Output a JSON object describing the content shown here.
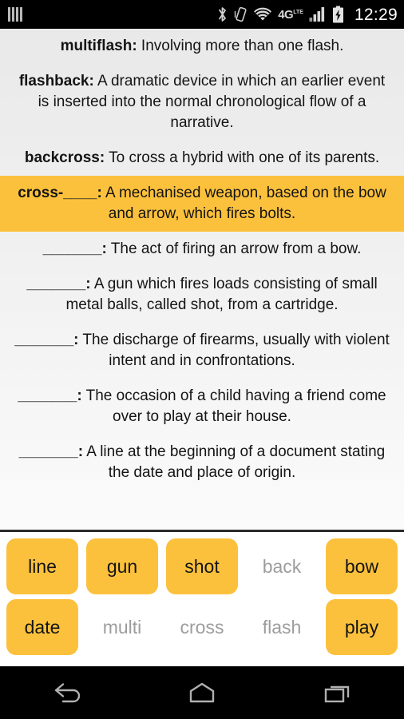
{
  "status_bar": {
    "app_icon": "bars-icon",
    "icons": [
      {
        "name": "bluetooth-icon",
        "label": "Bluetooth"
      },
      {
        "name": "vibrate-icon",
        "label": "Vibrate"
      },
      {
        "name": "wifi-icon",
        "label": "Wi-Fi"
      },
      {
        "name": "network-4g-lte-icon",
        "label_big": "4G",
        "label_small": "LTE"
      },
      {
        "name": "cellular-signal-icon",
        "label": "Signal"
      },
      {
        "name": "battery-charging-icon",
        "label": "Battery charging"
      }
    ],
    "clock": "12:29"
  },
  "content": {
    "definitions": [
      {
        "term": "multiflash",
        "separator": ":",
        "text": " Involving more than one flash.",
        "state": "solved",
        "highlighted": false
      },
      {
        "term": "flashback",
        "separator": ":",
        "text": " A dramatic device in which an earlier event is inserted into the normal chronological flow of a narrative.",
        "state": "solved",
        "highlighted": false
      },
      {
        "term": "backcross",
        "separator": ":",
        "text": " To cross a hybrid with one of its parents.",
        "state": "solved",
        "highlighted": false
      },
      {
        "term": "cross-____",
        "separator": ":",
        "text": " A mechanised weapon, based on the bow and arrow, which fires bolts.",
        "state": "current",
        "highlighted": true
      },
      {
        "term": "_______",
        "separator": ":",
        "text": " The act of firing an arrow from a bow.",
        "state": "unsolved",
        "highlighted": false
      },
      {
        "term": "_______",
        "separator": ":",
        "text": " A gun which fires loads consisting of small metal balls, called shot, from a cartridge.",
        "state": "unsolved",
        "highlighted": false
      },
      {
        "term": "_______",
        "separator": ":",
        "text": " The discharge of firearms, usually with violent intent and in confrontations.",
        "state": "unsolved",
        "highlighted": false
      },
      {
        "term": "_______",
        "separator": ":",
        "text": " The occasion of a child having a friend come over to play at their house.",
        "state": "unsolved",
        "highlighted": false
      },
      {
        "term": "_______",
        "separator": ":",
        "text": " A line at the beginning of a document stating the date and place of origin.",
        "state": "unsolved",
        "highlighted": false
      }
    ]
  },
  "word_bank": {
    "rows": [
      [
        {
          "label": "line",
          "state": "available"
        },
        {
          "label": "gun",
          "state": "available"
        },
        {
          "label": "shot",
          "state": "available"
        },
        {
          "label": "back",
          "state": "used"
        },
        {
          "label": "bow",
          "state": "available"
        }
      ],
      [
        {
          "label": "date",
          "state": "available"
        },
        {
          "label": "multi",
          "state": "used"
        },
        {
          "label": "cross",
          "state": "used"
        },
        {
          "label": "flash",
          "state": "used"
        },
        {
          "label": "play",
          "state": "available"
        }
      ]
    ]
  },
  "nav_bar": {
    "buttons": [
      {
        "name": "back-icon",
        "label": "Back"
      },
      {
        "name": "home-icon",
        "label": "Home"
      },
      {
        "name": "recents-icon",
        "label": "Recent apps"
      }
    ]
  },
  "colors": {
    "accent_orange": "#fcc13c",
    "used_word_gray": "#9d9d9d",
    "text_dark": "#141414",
    "status_bar_bg": "#000000"
  }
}
